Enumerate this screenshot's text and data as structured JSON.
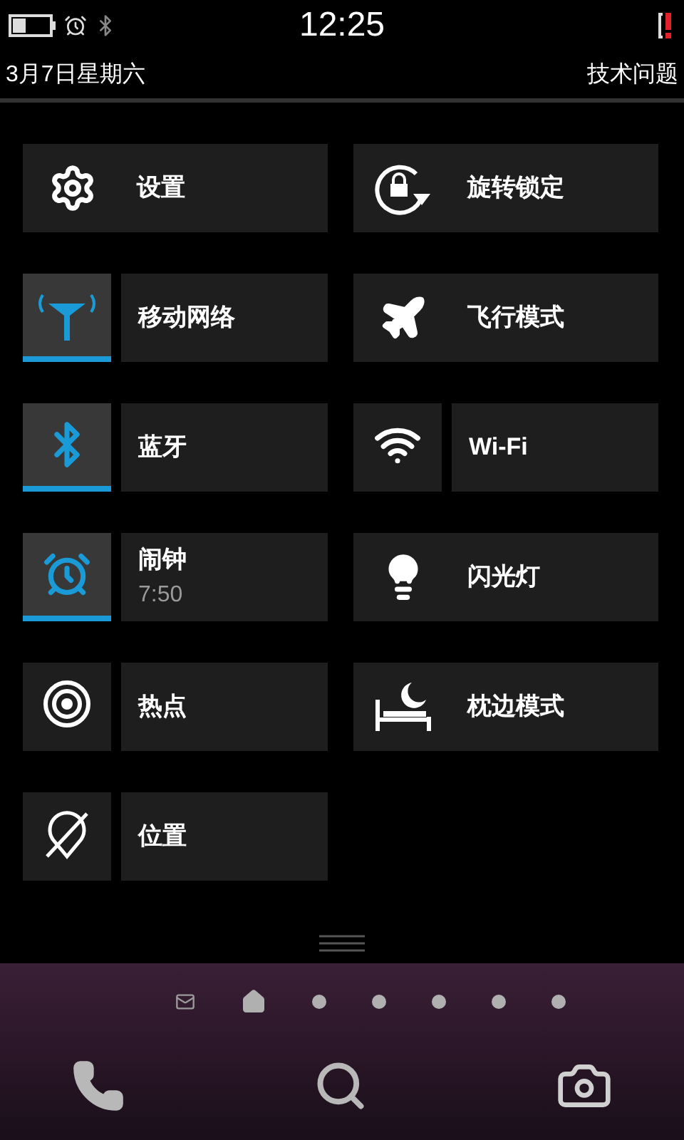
{
  "status_bar": {
    "time": "12:25"
  },
  "header": {
    "date": "3月7日星期六",
    "link": "技术问题"
  },
  "tiles": [
    {
      "kind": "full",
      "label": "设置"
    },
    {
      "kind": "full",
      "label": "旋转锁定"
    },
    {
      "kind": "split",
      "label": "移动网络",
      "on": true
    },
    {
      "kind": "full",
      "label": "飞行模式"
    },
    {
      "kind": "split",
      "label": "蓝牙",
      "on": true
    },
    {
      "kind": "split",
      "label": "Wi-Fi",
      "on": false
    },
    {
      "kind": "split",
      "label": "闹钟",
      "sublabel": "7:50",
      "on": true
    },
    {
      "kind": "full",
      "label": "闪光灯"
    },
    {
      "kind": "split",
      "label": "热点",
      "on": false
    },
    {
      "kind": "full",
      "label": "枕边模式"
    },
    {
      "kind": "split",
      "label": "位置",
      "on": false
    }
  ],
  "page_indicator": [
    {
      "kind": "mail"
    },
    {
      "kind": "home"
    },
    {
      "kind": "dot"
    },
    {
      "kind": "dot"
    },
    {
      "kind": "dot"
    },
    {
      "kind": "dot"
    },
    {
      "kind": "dot"
    }
  ]
}
